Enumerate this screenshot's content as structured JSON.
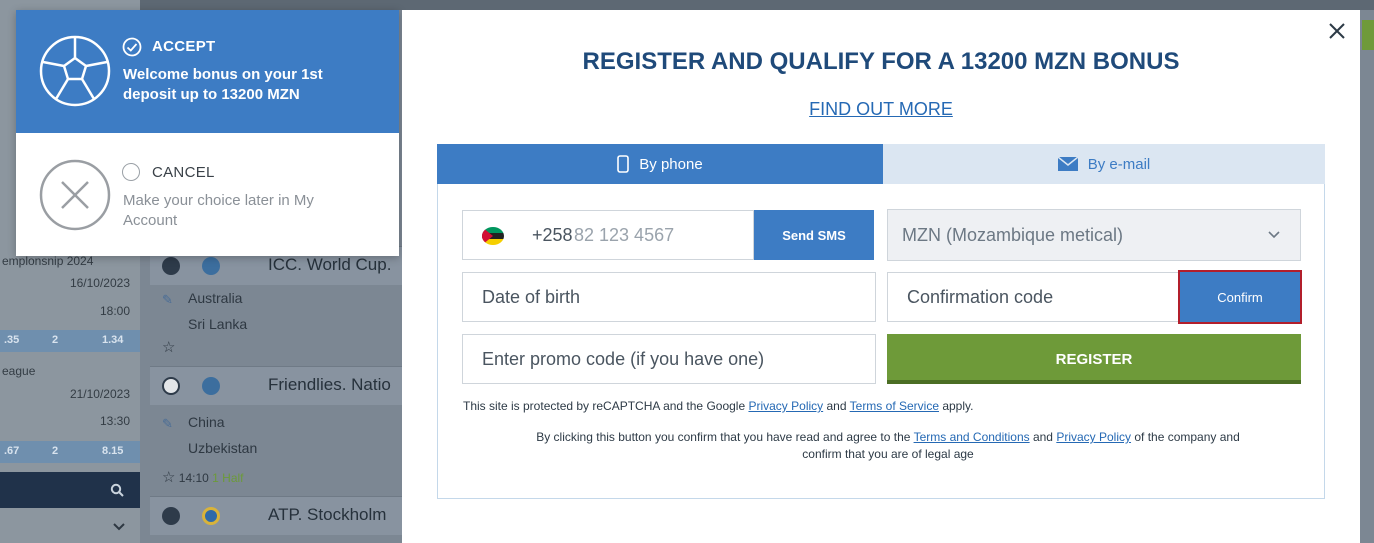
{
  "background": {
    "sidebar_rows": [
      {
        "text": "emplonsnip 2024"
      },
      {
        "text": "eague"
      }
    ],
    "dates": [
      {
        "date": "16/10/2023",
        "time": "18:00"
      },
      {
        "date": "21/10/2023",
        "time": "13:30"
      }
    ],
    "odds_rows": [
      {
        "a": ".35",
        "b": "2",
        "c": "1.34"
      },
      {
        "a": ".67",
        "b": "2",
        "c": "8.15"
      }
    ],
    "leagues": [
      {
        "name": "ICC. World Cup."
      },
      {
        "name": "Friendlies. Natio"
      },
      {
        "name": "ATP. Stockholm"
      }
    ],
    "matches": [
      {
        "team1": "Australia",
        "team2": "Sri Lanka"
      },
      {
        "team1": "China",
        "team2": "Uzbekistan"
      }
    ],
    "live_time": "14:10",
    "live_half": "1 Half"
  },
  "bonus": {
    "accept_title": "ACCEPT",
    "accept_text": "Welcome bonus on your 1st deposit up to 13200 MZN",
    "cancel_title": "CANCEL",
    "cancel_text": "Make your choice later in My Account"
  },
  "modal": {
    "title": "REGISTER AND QUALIFY FOR A 13200 MZN BONUS",
    "find_out_more": "FIND OUT MORE",
    "tabs": [
      {
        "label": "By phone",
        "icon": "phone-icon"
      },
      {
        "label": "By e-mail",
        "icon": "envelope-icon"
      }
    ],
    "phone": {
      "prefix": "+258",
      "placeholder": "82 123 4567",
      "send_sms": "Send SMS"
    },
    "currency": "MZN (Mozambique metical)",
    "date_of_birth": "Date of birth",
    "confirmation_code": "Confirmation code",
    "confirm": "Confirm",
    "promo_code": "Enter promo code (if you have one)",
    "register": "REGISTER",
    "recaptcha": {
      "pre": "This site is protected by reCAPTCHA and the Google ",
      "privacy": "Privacy Policy",
      "and": " and ",
      "terms": "Terms of Service",
      "post": " apply."
    },
    "consent": {
      "pre": "By clicking this button you confirm that you have read and agree to the ",
      "terms": "Terms and Conditions",
      "and": " and ",
      "privacy": "Privacy Policy",
      "post": " of the company and",
      "line2": "confirm that you are of legal age"
    }
  },
  "colors": {
    "primary": "#3d7cc4",
    "register": "#6e9a39",
    "highlight_border": "#b21e2b",
    "title": "#1f4a7a"
  }
}
